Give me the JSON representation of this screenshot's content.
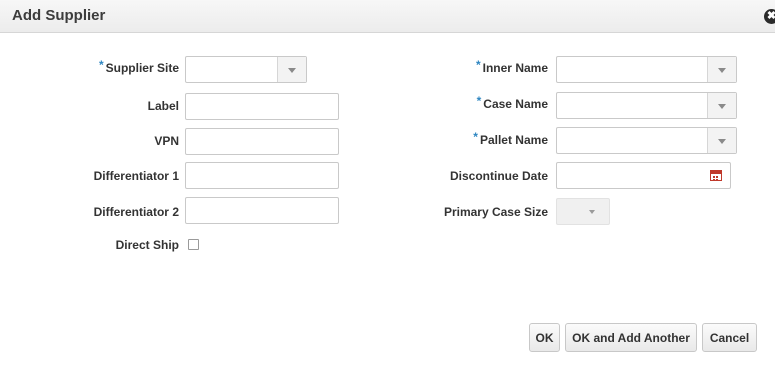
{
  "dialog": {
    "title": "Add Supplier",
    "close_glyph": "✖"
  },
  "required_marker": "*",
  "left_fields": {
    "supplier_site": {
      "label": "Supplier Site",
      "value": ""
    },
    "label": {
      "label": "Label",
      "value": ""
    },
    "vpn": {
      "label": "VPN",
      "value": ""
    },
    "differentiator_1": {
      "label": "Differentiator 1",
      "value": ""
    },
    "differentiator_2": {
      "label": "Differentiator 2",
      "value": ""
    },
    "direct_ship": {
      "label": "Direct Ship",
      "checked": false
    }
  },
  "right_fields": {
    "inner_name": {
      "label": "Inner Name",
      "value": ""
    },
    "case_name": {
      "label": "Case Name",
      "value": ""
    },
    "pallet_name": {
      "label": "Pallet Name",
      "value": ""
    },
    "discontinue_date": {
      "label": "Discontinue Date",
      "value": ""
    },
    "primary_case_size": {
      "label": "Primary Case Size",
      "value": ""
    }
  },
  "buttons": {
    "ok": "OK",
    "ok_and_add_another": "OK and Add Another",
    "cancel": "Cancel"
  },
  "icons": {
    "dropdown": "chevron-down-icon",
    "calendar": "calendar-icon",
    "close": "close-icon"
  },
  "colors": {
    "required_star": "#2e86c1",
    "calendar_icon": "#c0392b"
  }
}
